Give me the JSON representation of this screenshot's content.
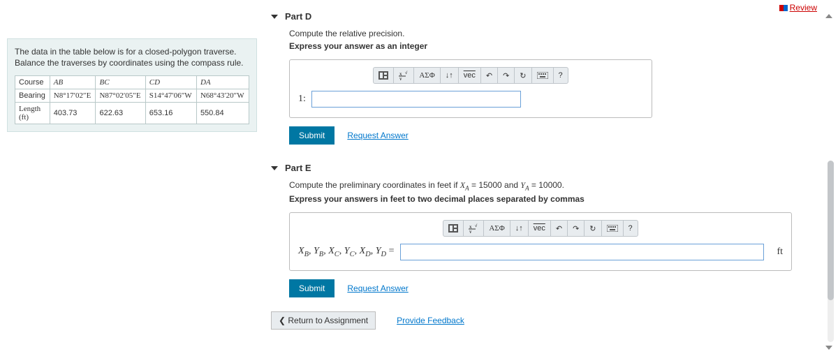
{
  "review_label": "Review",
  "problem": {
    "text": "The data in the table below is for a closed-polygon traverse. Balance the traverses by coordinates using the compass rule.",
    "rows": {
      "course_label": "Course",
      "bearing_label": "Bearing",
      "length_label": "Length (ft)"
    },
    "courses": [
      "AB",
      "BC",
      "CD",
      "DA"
    ],
    "bearings": [
      "N8°17′02″E",
      "N87°02′05″E",
      "S14°47′06″W",
      "N68°43′20″W"
    ],
    "lengths": [
      "403.73",
      "622.63",
      "653.16",
      "550.84"
    ]
  },
  "partD": {
    "title": "Part D",
    "prompt": "Compute the relative precision.",
    "instr": "Express your answer as an integer",
    "prefix": "1:",
    "submit": "Submit",
    "request": "Request Answer"
  },
  "partE": {
    "title": "Part E",
    "prompt_pre": "Compute the preliminary coordinates in feet if ",
    "prompt_mid": " = 15000 and ",
    "prompt_post": " = 10000.",
    "instr": "Express your answers in feet to two decimal places separated by commas",
    "unit": "ft",
    "submit": "Submit",
    "request": "Request Answer"
  },
  "toolbar": {
    "greek": "ΑΣΦ",
    "vec": "vec",
    "help": "?"
  },
  "footer": {
    "return": "Return to Assignment",
    "feedback": "Provide Feedback"
  }
}
